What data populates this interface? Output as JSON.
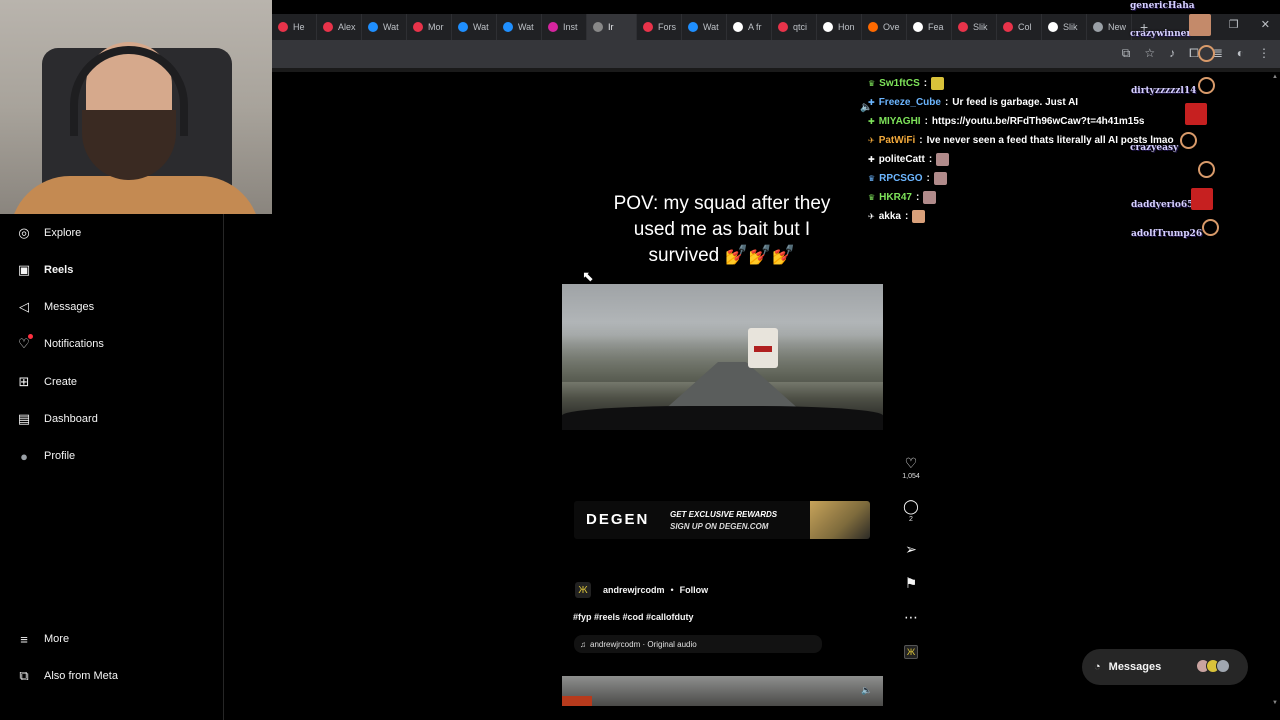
{
  "browser": {
    "tabs": [
      {
        "label": "He",
        "color": "#e8334a"
      },
      {
        "label": "Alex",
        "color": "#e8334a"
      },
      {
        "label": "Wat",
        "color": "#1f8fff"
      },
      {
        "label": "Mor",
        "color": "#e8334a"
      },
      {
        "label": "Wat",
        "color": "#1f8fff"
      },
      {
        "label": "Wat",
        "color": "#1f8fff"
      },
      {
        "label": "Inst",
        "color": "#d6249f"
      },
      {
        "label": "Ir",
        "color": "#888888"
      },
      {
        "label": "Fors",
        "color": "#e8334a"
      },
      {
        "label": "Wat",
        "color": "#1f8fff"
      },
      {
        "label": "A fr",
        "color": "#ffffff"
      },
      {
        "label": "qtci",
        "color": "#e8334a"
      },
      {
        "label": "Hon",
        "color": "#ffffff"
      },
      {
        "label": "Ove",
        "color": "#ff6a00"
      },
      {
        "label": "Fea",
        "color": "#ffffff"
      },
      {
        "label": "Slik",
        "color": "#e8334a"
      },
      {
        "label": "Col",
        "color": "#e8334a"
      },
      {
        "label": "Slik",
        "color": "#ffffff"
      },
      {
        "label": "New",
        "color": "#9aa0a6"
      }
    ],
    "new_tab": "+",
    "window_controls": [
      "—",
      "❐",
      "✕"
    ]
  },
  "sidebar": {
    "items": [
      {
        "label": "Explore",
        "icon": "compass-icon",
        "glyph": "◎"
      },
      {
        "label": "Reels",
        "icon": "reels-icon",
        "glyph": "▣",
        "active": true
      },
      {
        "label": "Messages",
        "icon": "send-icon",
        "glyph": "◁"
      },
      {
        "label": "Notifications",
        "icon": "heart-icon",
        "glyph": "♡"
      },
      {
        "label": "Create",
        "icon": "plus-square-icon",
        "glyph": "⊞"
      },
      {
        "label": "Dashboard",
        "icon": "dashboard-icon",
        "glyph": "▤"
      },
      {
        "label": "Profile",
        "icon": "avatar-icon",
        "glyph": "●"
      }
    ],
    "bottom_items": [
      {
        "label": "More",
        "icon": "menu-icon",
        "glyph": "≡"
      },
      {
        "label": "Also from Meta",
        "icon": "meta-icon",
        "glyph": "⧉"
      }
    ]
  },
  "reel": {
    "caption_lines": [
      "POV: my squad after they",
      "used me as bait but I",
      "survived 💅💅💅"
    ],
    "ad": {
      "brand": "DEGEN",
      "line1": "GET EXCLUSIVE REWARDS",
      "line2": "SIGN UP ON DEGEN.COM"
    },
    "author": "andrewjrcodm",
    "separator": "•",
    "follow_label": "Follow",
    "hashtags": "#fyp #reels #cod #callofduty",
    "audio": "andrewjrcodm · Original audio",
    "likes": "1,054",
    "comments": "2"
  },
  "chat": [
    {
      "user": "Sw1ftCS",
      "message": "",
      "color": "#7ee35a",
      "badge": "♛",
      "emote": "#d9c23a"
    },
    {
      "user": "Freeze_Cube",
      "message": "Ur feed is garbage. Just AI",
      "color": "#6cb6ff",
      "badge": "✚",
      "emote": ""
    },
    {
      "user": "MIYAGHI",
      "message": "https://youtu.be/RFdTh96wCaw?t=4h41m15s",
      "color": "#7ee35a",
      "badge": "✚",
      "emote": ""
    },
    {
      "user": "PatWiFi",
      "message": "Ive never seen a feed thats literally all AI posts lmao",
      "color": "#f2a93b",
      "badge": "✈",
      "emote": ""
    },
    {
      "user": "politeCatt",
      "message": "",
      "color": "#ffffff",
      "badge": "✚",
      "emote": "#b08a8a"
    },
    {
      "user": "RPCSGO",
      "message": "",
      "color": "#6cb6ff",
      "badge": "♛",
      "emote": "#b08a8a"
    },
    {
      "user": "HKR47",
      "message": "",
      "color": "#7ee35a",
      "badge": "♛",
      "emote": "#b08a8a"
    },
    {
      "user": "akka",
      "message": "",
      "color": "#ffffff",
      "badge": "✈",
      "emote": "#d9a07a"
    }
  ],
  "alerts": [
    "genericHaha",
    "crazywinner",
    "dirtyzzzzzl14",
    "crazyeasy",
    "daddyerio65",
    "adolfTrump26"
  ],
  "messages_pill": {
    "label": "Messages"
  }
}
